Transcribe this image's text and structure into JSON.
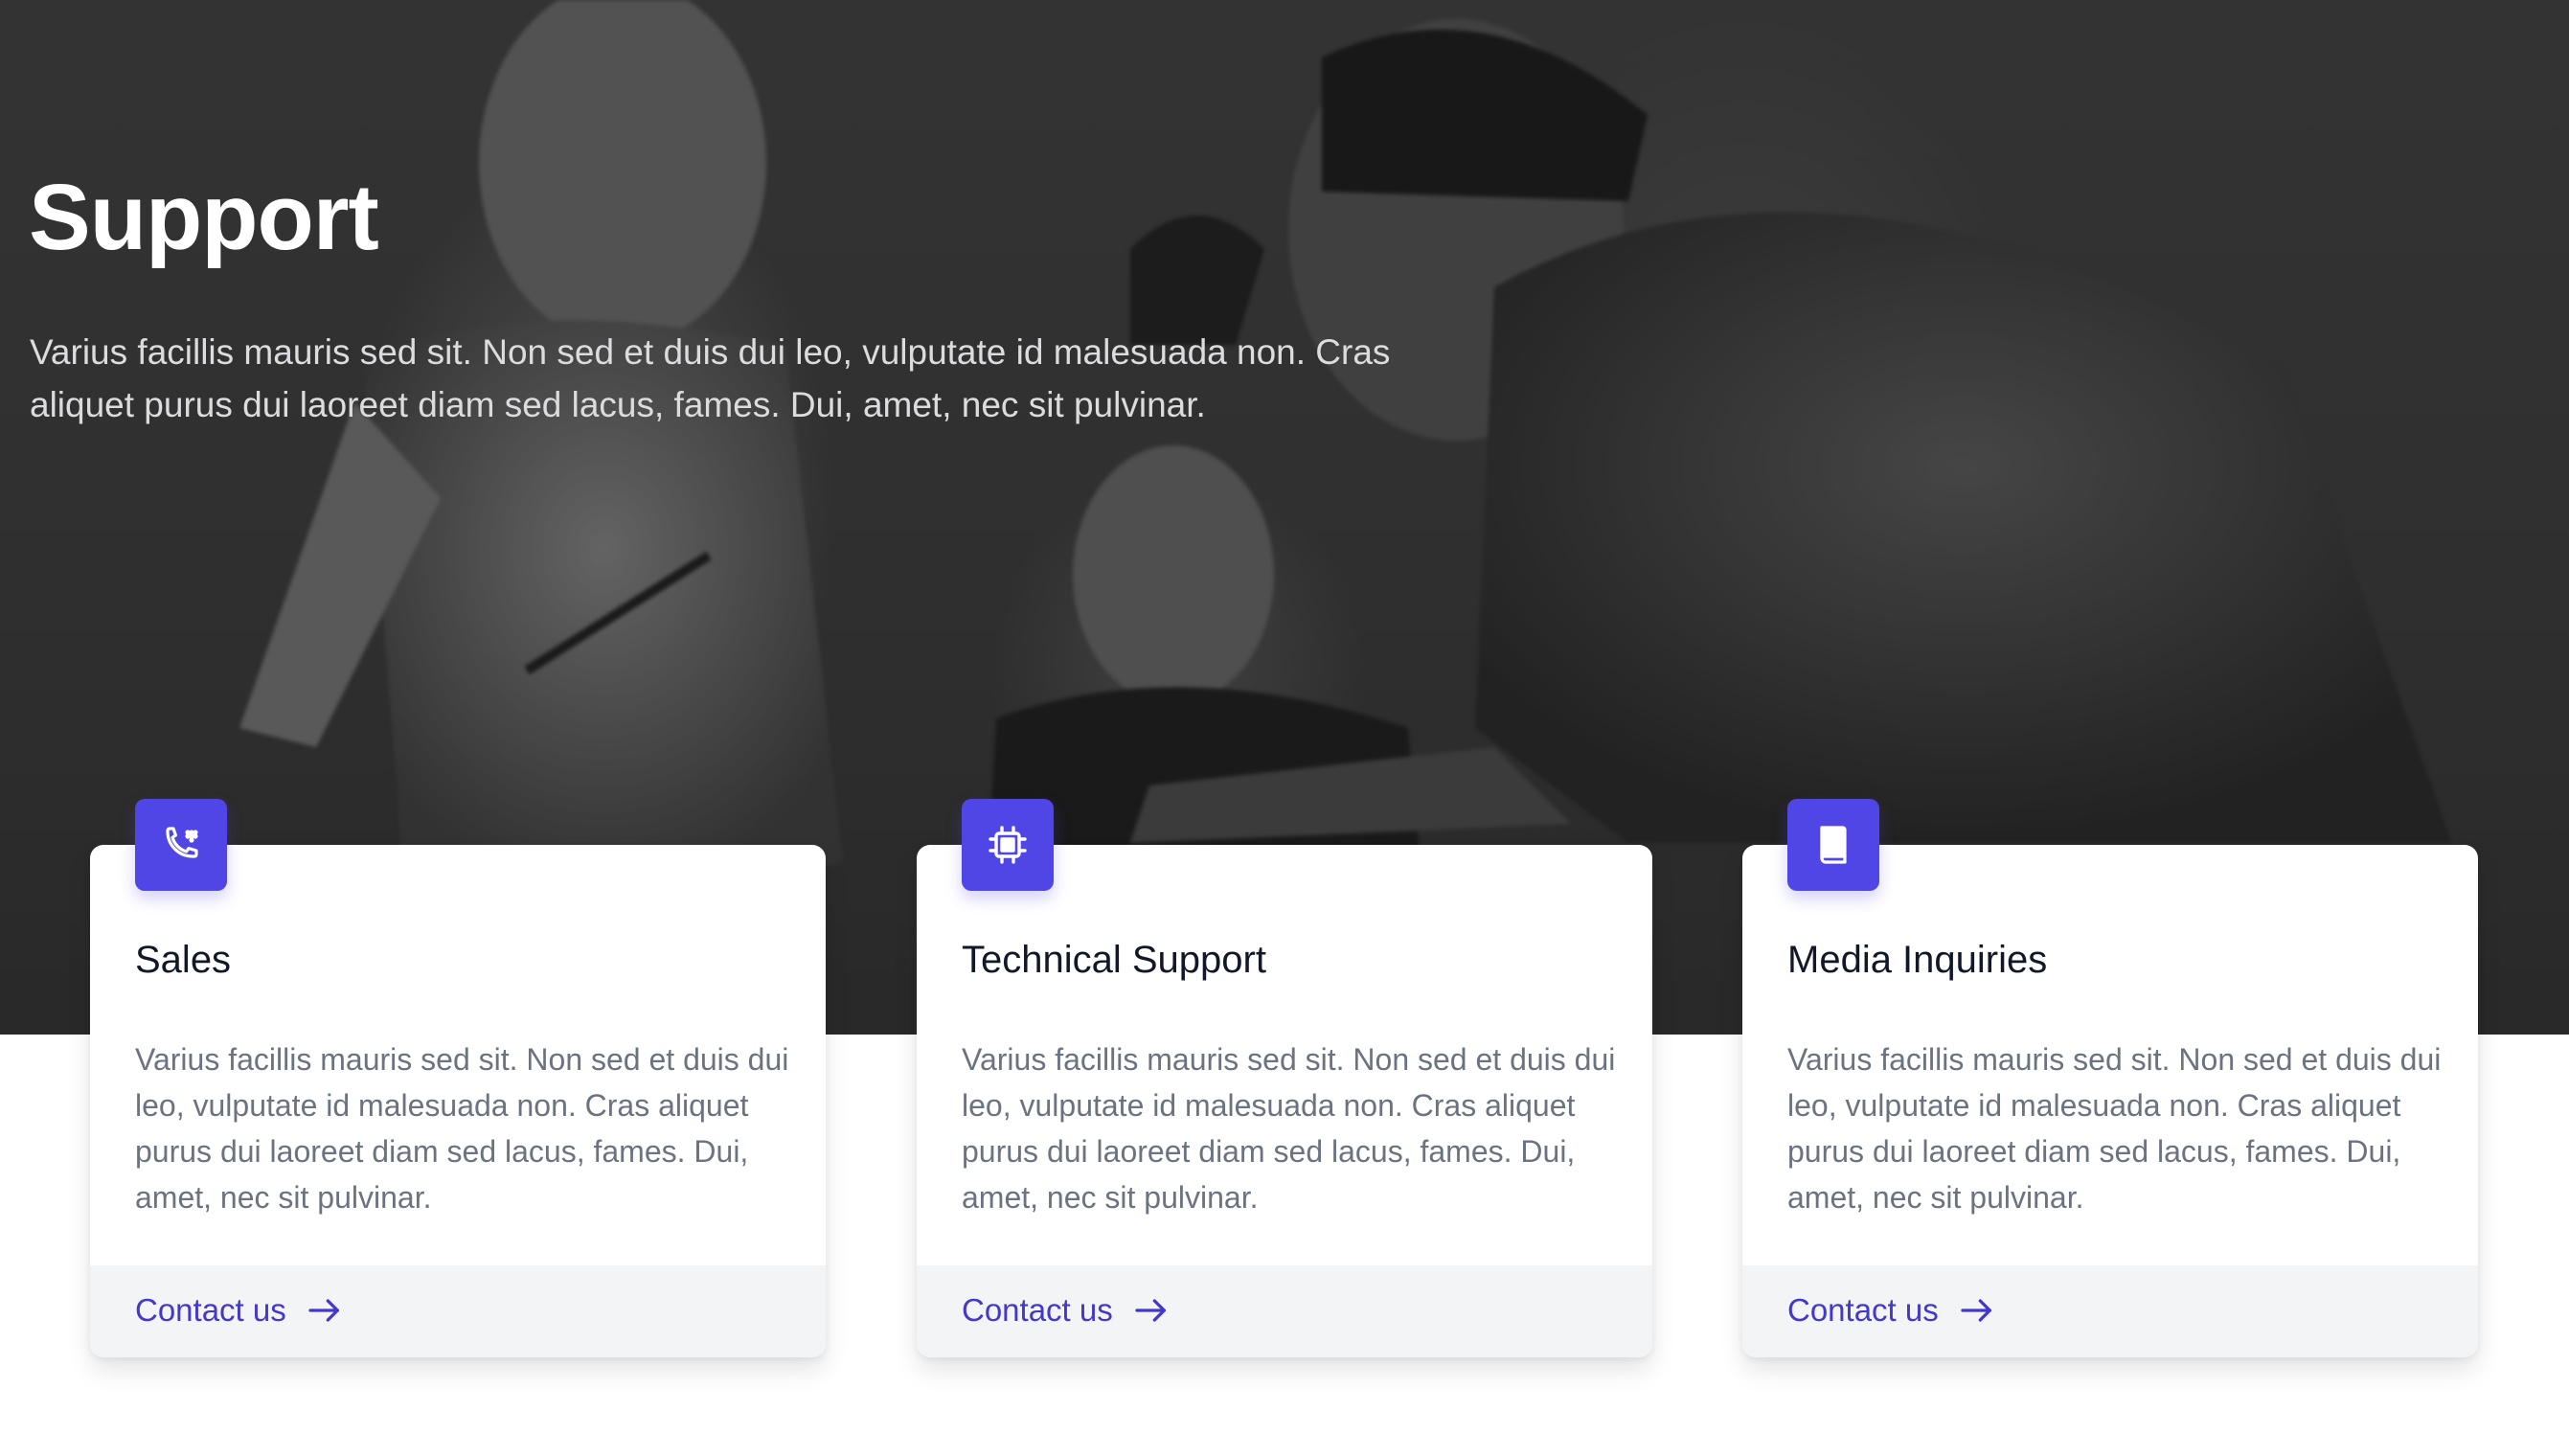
{
  "hero": {
    "title": "Support",
    "description": "Varius facillis mauris sed sit. Non sed et duis dui leo, vulputate id malesuada non. Cras aliquet purus dui laoreet diam sed lacus, fames. Dui, amet, nec sit pulvinar."
  },
  "cards": [
    {
      "icon": "phone-icon",
      "title": "Sales",
      "text": "Varius facillis mauris sed sit. Non sed et duis dui leo, vulputate id malesuada non. Cras aliquet purus dui laoreet diam sed lacus, fames. Dui, amet, nec sit pulvinar.",
      "link": "Contact us"
    },
    {
      "icon": "chip-icon",
      "title": "Technical Support",
      "text": "Varius facillis mauris sed sit. Non sed et duis dui leo, vulputate id malesuada non. Cras aliquet purus dui laoreet diam sed lacus, fames. Dui, amet, nec sit pulvinar.",
      "link": "Contact us"
    },
    {
      "icon": "book-icon",
      "title": "Media Inquiries",
      "text": "Varius facillis mauris sed sit. Non sed et duis dui leo, vulputate id malesuada non. Cras aliquet purus dui laoreet diam sed lacus, fames. Dui, amet, nec sit pulvinar.",
      "link": "Contact us"
    }
  ],
  "colors": {
    "accent": "#4f46e5",
    "link": "#4338ca",
    "title": "#111827",
    "body_text": "#6b7280",
    "footer_bg": "#f3f4f6"
  }
}
